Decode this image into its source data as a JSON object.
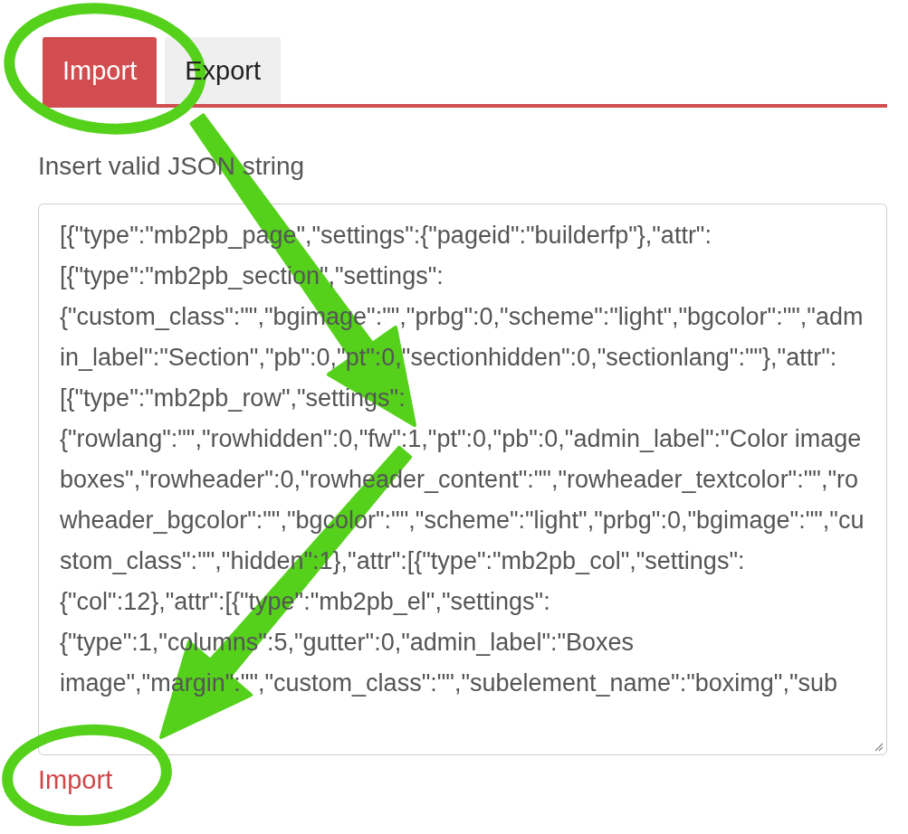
{
  "tabs": [
    {
      "label": "Import",
      "selected": true
    },
    {
      "label": "Export",
      "selected": false
    }
  ],
  "import_panel": {
    "label": "Insert valid JSON string",
    "json_input": {
      "value": "[{\"type\":\"mb2pb_page\",\"settings\":{\"pageid\":\"builderfp\"},\"attr\":[{\"type\":\"mb2pb_section\",\"settings\":{\"custom_class\":\"\",\"bgimage\":\"\",\"prbg\":0,\"scheme\":\"light\",\"bgcolor\":\"\",\"admin_label\":\"Section\",\"pb\":0,\"pt\":0,\"sectionhidden\":0,\"sectionlang\":\"\"},\"attr\":[{\"type\":\"mb2pb_row\",\"settings\":{\"rowlang\":\"\",\"rowhidden\":0,\"fw\":1,\"pt\":0,\"pb\":0,\"admin_label\":\"Color image boxes\",\"rowheader\":0,\"rowheader_content\":\"\",\"rowheader_textcolor\":\"\",\"rowheader_bgcolor\":\"\",\"bgcolor\":\"\",\"scheme\":\"light\",\"prbg\":0,\"bgimage\":\"\",\"custom_class\":\"\",\"hidden\":1},\"attr\":[{\"type\":\"mb2pb_col\",\"settings\":{\"col\":12},\"attr\":[{\"type\":\"mb2pb_el\",\"settings\":{\"type\":1,\"columns\":5,\"gutter\":0,\"admin_label\":\"Boxes image\",\"margin\":\"\",\"custom_class\":\"\",\"subelement_name\":\"boximg\",\"sub"
    },
    "submit_link": "Import"
  }
}
